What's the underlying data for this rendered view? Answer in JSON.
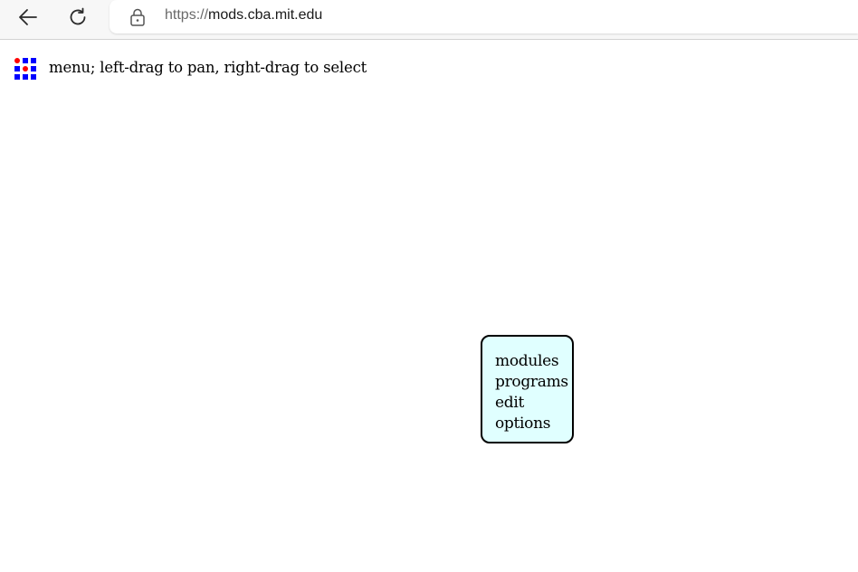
{
  "browser": {
    "url_protocol": "https://",
    "url_host": "mods.cba.mit.edu",
    "back_icon": "arrow-left-icon",
    "reload_icon": "reload-icon",
    "lock_icon": "lock-icon"
  },
  "page": {
    "menu_icon": "grid-menu-icon",
    "hint": "menu; left-drag to pan, right-drag to select"
  },
  "context_menu": {
    "background": "#e0ffff",
    "items": [
      {
        "label": "modules"
      },
      {
        "label": "programs"
      },
      {
        "label": "edit"
      },
      {
        "label": "options"
      }
    ]
  },
  "colors": {
    "icon_blue": "#0000ff",
    "icon_red": "#ff0000"
  }
}
